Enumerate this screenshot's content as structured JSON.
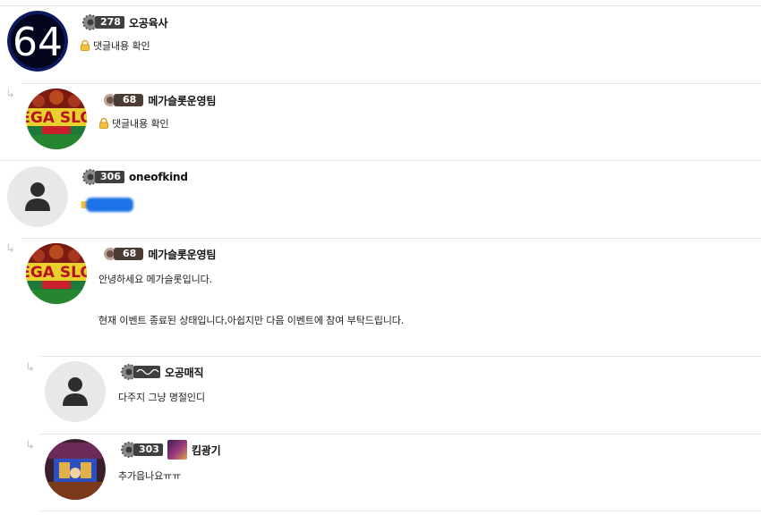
{
  "comments": [
    {
      "avatar_text": "64",
      "level": "278",
      "nickname": "오공육사",
      "body": "댓글내용 확인",
      "locked": true
    },
    {
      "level": "68",
      "nickname": "메가슬롯운영팀",
      "body": "댓글내용 확인",
      "locked": true,
      "reply": true
    },
    {
      "level": "306",
      "nickname": "oneofkind",
      "body_hidden": true
    },
    {
      "level": "68",
      "nickname": "메가슬롯운영팀",
      "reply": true,
      "body_lines": [
        "안녕하세요 메가슬롯입니다.",
        "현재 이벤트 종료된 상태입니다,아쉽지만 다음 이벤트에 참여 부탁드립니다."
      ]
    },
    {
      "level": "",
      "nickname": "오공매직",
      "body": "다주지 그냥 명절인디",
      "reply": true
    },
    {
      "level": "303",
      "nickname": "킴광기",
      "body": "추가읍나요ㅠㅠ",
      "reply": true
    }
  ],
  "icons": {
    "reply_arrow": "↳",
    "lock": "lock-icon",
    "gear": "gear-badge-icon"
  },
  "colors": {
    "divider": "#e3e3e3",
    "badge_dark": "#3f3f3f",
    "badge_bronze": "#4a3b33",
    "mask_blue": "#1e73e8",
    "avatar_default_bg": "#e8e8e8"
  }
}
